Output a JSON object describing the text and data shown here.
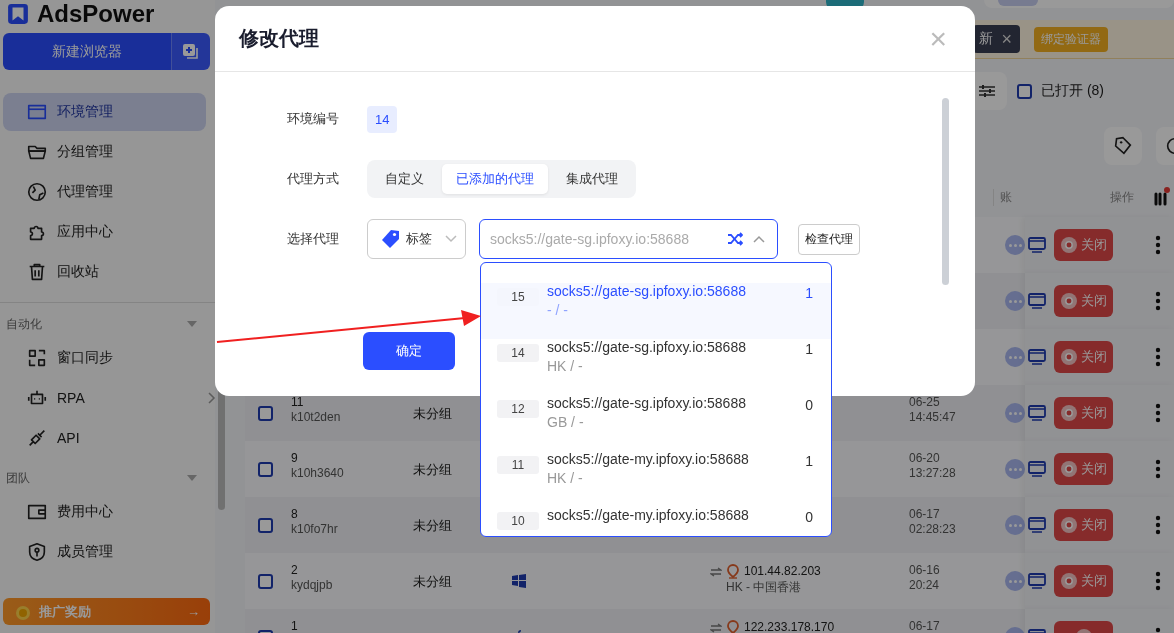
{
  "app": {
    "logo": "AdsPower"
  },
  "sidebar": {
    "new_button": "新建浏览器",
    "sections": [
      {
        "items": [
          {
            "label": "环境管理",
            "selected": true,
            "expandable": false
          },
          {
            "label": "分组管理",
            "selected": false,
            "expandable": false
          },
          {
            "label": "代理管理",
            "selected": false,
            "expandable": false
          },
          {
            "label": "应用中心",
            "selected": false,
            "expandable": false
          },
          {
            "label": "回收站",
            "selected": false,
            "expandable": false
          }
        ]
      },
      {
        "title": "自动化",
        "items": [
          {
            "label": "窗口同步",
            "selected": false,
            "expandable": false
          },
          {
            "label": "RPA",
            "selected": false,
            "expandable": true
          },
          {
            "label": "API",
            "selected": false,
            "expandable": false
          }
        ]
      },
      {
        "title": "团队",
        "items": [
          {
            "label": "费用中心",
            "selected": false,
            "expandable": false
          },
          {
            "label": "成员管理",
            "selected": false,
            "expandable": false
          }
        ]
      }
    ],
    "promo": {
      "label": "推广奖励",
      "arrow": "→"
    }
  },
  "top": {
    "notice_text": "新",
    "notice_close": "×",
    "bind_button": "绑定验证器",
    "opened_filter": {
      "label": "已打开 (8)",
      "checked": false
    }
  },
  "table": {
    "columns": [
      "账",
      "操作"
    ],
    "rows": [
      {
        "action": "关闭"
      },
      {
        "action": "关闭"
      },
      {
        "action": "关闭"
      },
      {
        "id": "11",
        "checked": false,
        "name": "k10t2den",
        "group": "未分组",
        "date": "06-25",
        "time": "14:45:47",
        "action": "关闭"
      },
      {
        "id": "9",
        "checked": false,
        "name": "k10h3640",
        "group": "未分组",
        "date": "06-20",
        "time": "13:27:28",
        "action": "关闭"
      },
      {
        "id": "8",
        "checked": false,
        "name": "k10fo7hr",
        "group": "未分组",
        "date": "06-17",
        "time": "02:28:23",
        "action": "关闭"
      },
      {
        "id": "2",
        "checked": false,
        "name": "kydqjpb",
        "group": "未分组",
        "kind": "windows",
        "proxy_ip": "101.44.82.203",
        "proxy_location": "HK - 中国香港",
        "date": "06-16",
        "time": "20:24",
        "action": "关闭"
      },
      {
        "id": "1",
        "checked": false,
        "kind": "apple",
        "proxy_ip": "122.233.178.170",
        "date": "06-17"
      }
    ]
  },
  "dialog": {
    "title": "修改代理",
    "close": "×",
    "env_label": "环境编号",
    "env_number": "14",
    "mode_label": "代理方式",
    "modes": [
      {
        "label": "自定义",
        "selected": false
      },
      {
        "label": "已添加的代理",
        "selected": true
      },
      {
        "label": "集成代理",
        "selected": false
      }
    ],
    "select_label": "选择代理",
    "tag_select": "标签",
    "proxy_field": {
      "placeholder": "socks5://gate-sg.ipfoxy.io:58688"
    },
    "check_button": "检查代理",
    "confirm_button": "确定",
    "options": [
      {
        "id": "15",
        "url": "socks5://gate-sg.ipfoxy.io:58688",
        "sub": "- / -",
        "count": "1",
        "selected": true
      },
      {
        "id": "14",
        "url": "socks5://gate-sg.ipfoxy.io:58688",
        "sub": "HK / -",
        "count": "1",
        "selected": false
      },
      {
        "id": "12",
        "url": "socks5://gate-sg.ipfoxy.io:58688",
        "sub": "GB / -",
        "count": "0",
        "selected": false
      },
      {
        "id": "11",
        "url": "socks5://gate-my.ipfoxy.io:58688",
        "sub": "HK / -",
        "count": "1",
        "selected": false
      },
      {
        "id": "10",
        "url": "socks5://gate-my.ipfoxy.io:58688",
        "count": "0",
        "selected": false
      }
    ]
  }
}
